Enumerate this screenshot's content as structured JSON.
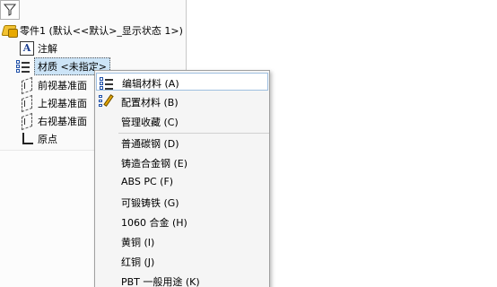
{
  "tree": {
    "part_label": "零件1 (默认<<默认>_显示状态 1>)",
    "notes_label": "注解",
    "material_label": "材质 <未指定>",
    "front_plane_label": "前视基准面",
    "top_plane_label": "上视基准面",
    "right_plane_label": "右视基准面",
    "origin_label": "原点"
  },
  "context_menu": {
    "items": [
      {
        "label": "编辑材料 (A)",
        "icon": "material-list-icon"
      },
      {
        "label": "配置材料 (B)",
        "icon": "pencil-material-icon"
      },
      {
        "label": "管理收藏 (C)",
        "icon": ""
      },
      {
        "label": "普通碳钢 (D)",
        "icon": ""
      },
      {
        "label": "铸造合金钢 (E)",
        "icon": ""
      },
      {
        "label": "ABS PC (F)",
        "icon": ""
      },
      {
        "label": "可锻铸铁 (G)",
        "icon": ""
      },
      {
        "label": "1060 合金 (H)",
        "icon": ""
      },
      {
        "label": "黄铜 (I)",
        "icon": ""
      },
      {
        "label": "红铜 (J)",
        "icon": ""
      },
      {
        "label": "PBT 一般用途 (K)",
        "icon": ""
      }
    ],
    "hovered_index": 0
  },
  "colors": {
    "selection": "#cce4f7",
    "hover_border": "#9fbfe0",
    "menu_background": "#f5f5f5"
  }
}
